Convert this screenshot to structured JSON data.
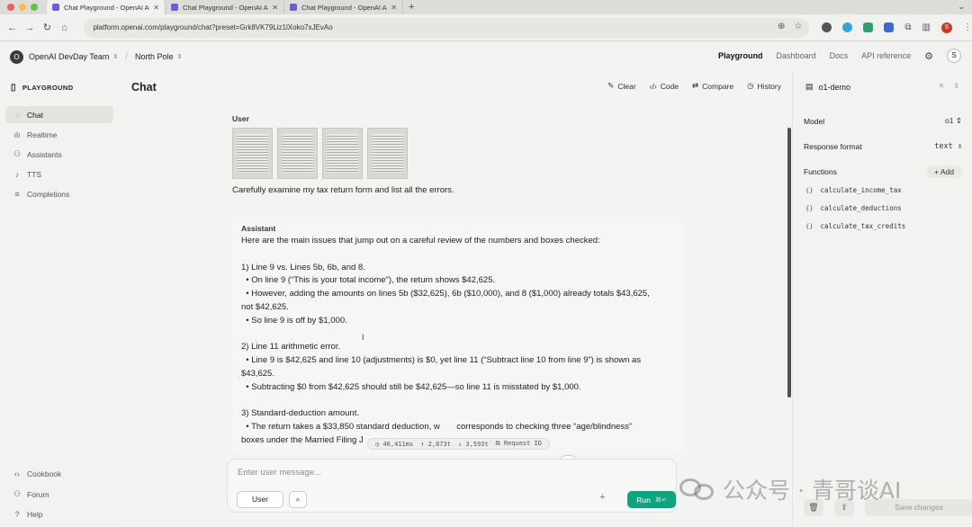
{
  "browser": {
    "tabs": [
      {
        "title": "Chat Playground - OpenAI AI",
        "active": true
      },
      {
        "title": "Chat Playground - OpenAI AI",
        "active": false
      },
      {
        "title": "Chat Playground - OpenAI AI",
        "active": false
      }
    ],
    "url": "platform.openai.com/playground/chat?preset=Grk8VK79Liz1lXoko7xJEvAo",
    "colors": {
      "close": "#ee5f57",
      "min": "#f4bd4f",
      "max": "#5dc542"
    },
    "profile_initial": "S"
  },
  "header": {
    "org_initial": "O",
    "org_name": "OpenAI DevDay Team",
    "project_name": "North Pole",
    "nav": [
      "Playground",
      "Dashboard",
      "Docs",
      "API reference"
    ],
    "user_initial": "S"
  },
  "sidebar": {
    "title": "PLAYGROUND",
    "items": [
      {
        "label": "Chat",
        "icon": "chat-bubble-icon",
        "active": true
      },
      {
        "label": "Realtime",
        "icon": "waveform-icon",
        "active": false
      },
      {
        "label": "Assistants",
        "icon": "people-icon",
        "active": false
      },
      {
        "label": "TTS",
        "icon": "microphone-icon",
        "active": false
      },
      {
        "label": "Completions",
        "icon": "lines-icon",
        "active": false
      }
    ],
    "footer": [
      {
        "label": "Cookbook",
        "icon": "code-icon"
      },
      {
        "label": "Forum",
        "icon": "people-icon"
      },
      {
        "label": "Help",
        "icon": "help-icon"
      }
    ]
  },
  "main": {
    "title": "Chat",
    "toolbar": [
      "Clear",
      "Code",
      "Compare",
      "History"
    ],
    "user_role": "User",
    "user_message": "Carefully examine my tax return form and list all the errors.",
    "attachment_count": 4,
    "assistant_role": "Assistant",
    "assistant_lines": [
      "Here are the main issues that jump out on a careful review of the numbers and boxes checked:",
      "",
      "1) Line 9 vs. Lines 5b, 6b, and 8.",
      "  • On line 9 (“This is your total income”), the return shows $42,625.",
      "  • However, adding the amounts on lines 5b ($32,625), 6b ($10,000), and 8 ($1,000) already totals $43,625,",
      "not $42,625.",
      "  • So line 9 is off by $1,000.",
      "",
      "2) Line 11 arithmetic error.",
      "  • Line 9 is $42,625 and line 10 (adjustments) is $0, yet line 11 (“Subtract line 10 from line 9”) is shown as",
      "$43,625.",
      "  • Subtracting $0 from $42,625 should still be $42,625—so line 11 is misstated by $1,000.",
      "",
      "3) Standard-deduction amount.",
      "  • The return takes a $33,850 standard deduction, w       corresponds to checking three “age/blindness”",
      "boxes under the Married Filing J"
    ],
    "meta": {
      "latency": "46,411ms",
      "tokens_in": "2,873t",
      "tokens_out": "3,593t",
      "request": "Request ID"
    },
    "composer": {
      "placeholder": "Enter user message...",
      "role_button": "User",
      "run_label": "Run",
      "run_shortcut": "⌘↵"
    }
  },
  "right_panel": {
    "preset_name": "o1-demo",
    "model_label": "Model",
    "model_value": "o1",
    "format_label": "Response format",
    "format_value": "text",
    "functions_label": "Functions",
    "add_label": "Add",
    "functions": [
      "calculate_income_tax",
      "calculate_deductions",
      "calculate_tax_credits"
    ],
    "save_label": "Save changes"
  },
  "watermark": {
    "text": "公众号 · 青哥谈AI"
  }
}
